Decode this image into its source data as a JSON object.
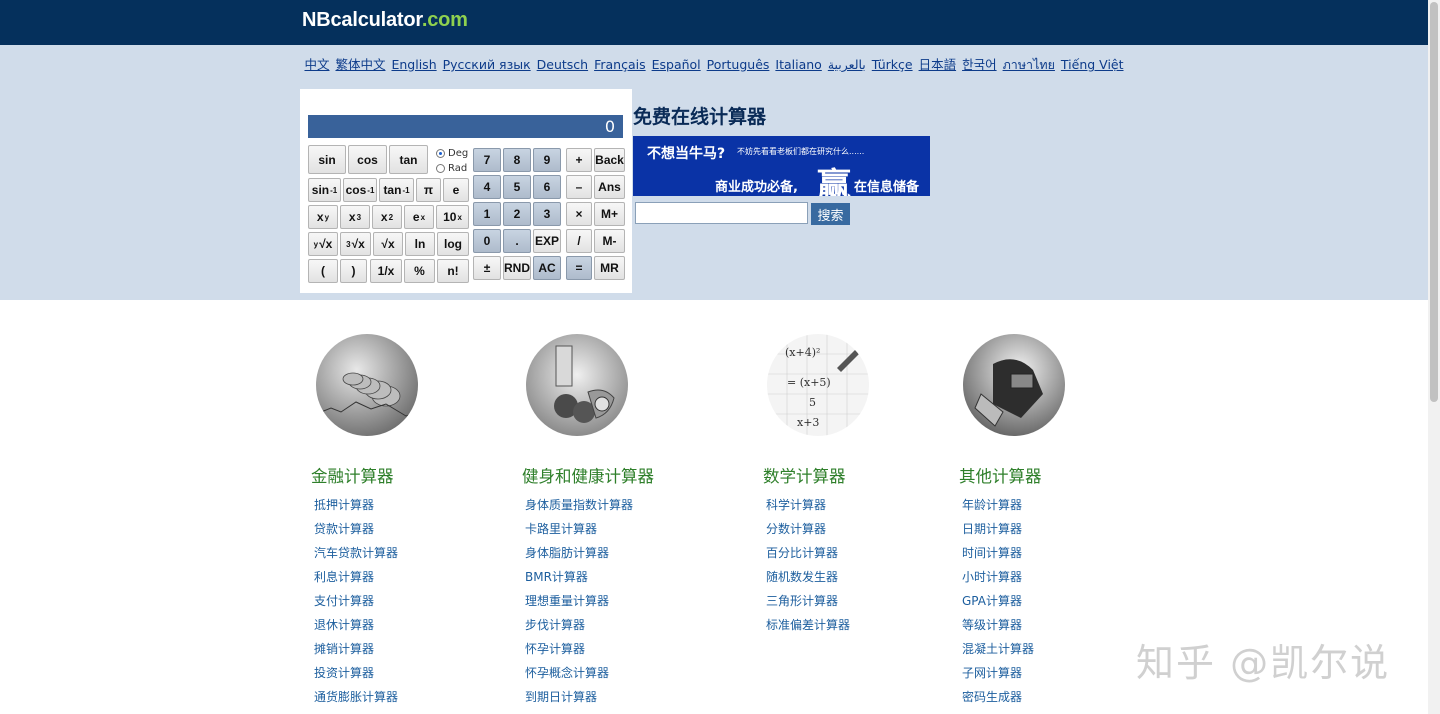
{
  "header": {
    "logo_main": "NBcalculator",
    "logo_domain": ".com"
  },
  "languages": [
    "中文",
    "繁体中文",
    "English",
    "Русский язык",
    "Deutsch",
    "Français",
    "Español",
    "Português",
    "Italiano",
    "بالعربية",
    "Türkçe",
    "日本語",
    "한국어",
    "ภาษาไทย",
    "Tiếng Việt"
  ],
  "calculator": {
    "display": "0",
    "angle_modes": [
      "Deg",
      "Rad"
    ],
    "selected_mode": "Deg",
    "func_labels": {
      "sin": "sin",
      "cos": "cos",
      "tan": "tan",
      "asin": "sin",
      "acos": "cos",
      "atan": "tan",
      "neg1": "-1",
      "pi": "π",
      "e": "e",
      "xy": "x",
      "y": "y",
      "x3": "x",
      "three": "3",
      "x2": "x",
      "two": "2",
      "ex": "e",
      "x": "x",
      "tenx": "10",
      "yroot": "√x",
      "cbrt": "√x",
      "sqrt": "√x",
      "ln": "ln",
      "log": "log",
      "lparen": "(",
      "rparen": ")",
      "recip": "1/x",
      "percent": "%",
      "fact": "n!"
    },
    "keypad": [
      [
        "7",
        "8",
        "9",
        "+",
        "Back"
      ],
      [
        "4",
        "5",
        "6",
        "–",
        "Ans"
      ],
      [
        "1",
        "2",
        "3",
        "×",
        "M+"
      ],
      [
        "0",
        ".",
        "EXP",
        "/",
        "M-"
      ],
      [
        "±",
        "RND",
        "AC",
        "=",
        "MR"
      ]
    ]
  },
  "calc_title": "免费在线计算器",
  "ad": {
    "line1": "不想当牛马?",
    "line2": "不妨先看看老板们都在研究什么......",
    "line3": "商业成功必备,",
    "big": "赢",
    "line4": "在信息储备"
  },
  "search": {
    "button": "搜索",
    "value": ""
  },
  "categories": [
    {
      "title": "金融计算器",
      "items": [
        "抵押计算器",
        "贷款计算器",
        "汽车贷款计算器",
        "利息计算器",
        "支付计算器",
        "退休计算器",
        "摊销计算器",
        "投资计算器",
        "通货膨胀计算器"
      ]
    },
    {
      "title": "健身和健康计算器",
      "items": [
        "身体质量指数计算器",
        "卡路里计算器",
        "身体脂肪计算器",
        "BMR计算器",
        "理想重量计算器",
        "步伐计算器",
        "怀孕计算器",
        "怀孕概念计算器",
        "到期日计算器"
      ]
    },
    {
      "title": "数学计算器",
      "items": [
        "科学计算器",
        "分数计算器",
        "百分比计算器",
        "随机数发生器",
        "三角形计算器",
        "标准偏差计算器"
      ]
    },
    {
      "title": "其他计算器",
      "items": [
        "年龄计算器",
        "日期计算器",
        "时间计算器",
        "小时计算器",
        "GPA计算器",
        "等级计算器",
        "混凝土计算器",
        "子网计算器",
        "密码生成器"
      ]
    }
  ],
  "watermark": "知乎 @凯尔说",
  "colors": {
    "header_bg": "#05305c",
    "band_bg": "#d0dcea",
    "display_bg": "#39629a",
    "heading_green": "#2e7f2a",
    "link_blue": "#1c5e9e"
  }
}
